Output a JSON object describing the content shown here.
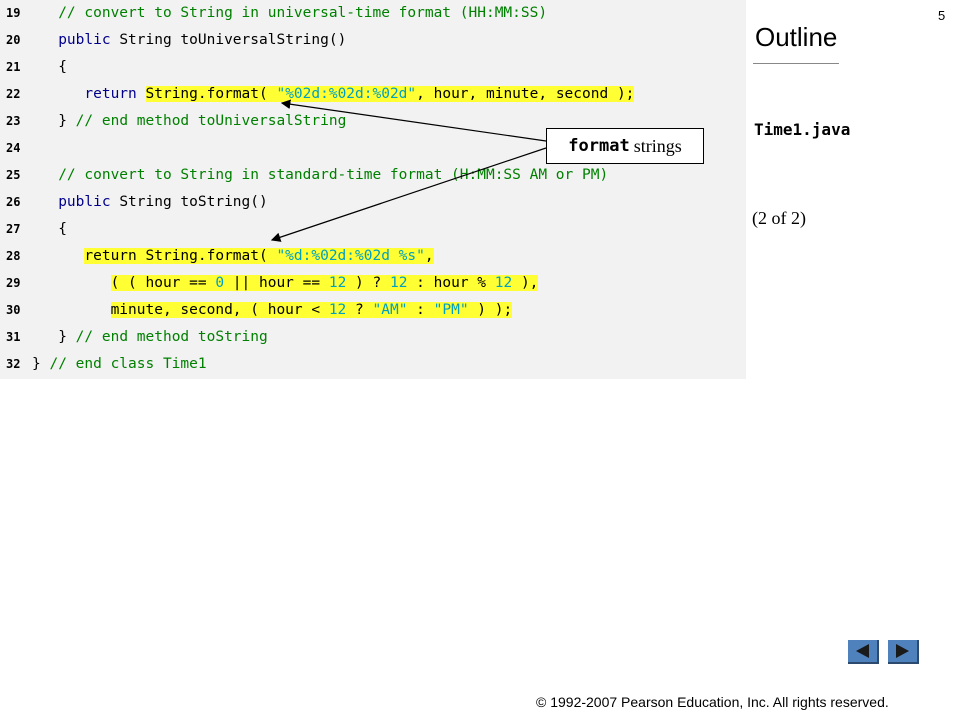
{
  "slide_number": "5",
  "sidebar": {
    "outline_title": "Outline",
    "filename": "Time1.java",
    "page_indicator": "(2 of 2)"
  },
  "callout": {
    "code_word": "format",
    "text": "strings"
  },
  "code_lines": [
    {
      "num": "19",
      "indent": "   ",
      "segments": [
        {
          "t": "// convert to String in universal-time format (HH:MM:SS)",
          "c": "cm"
        }
      ]
    },
    {
      "num": "20",
      "indent": "   ",
      "segments": [
        {
          "t": "public",
          "c": "kw"
        },
        {
          "t": " String toUniversalString()",
          "c": ""
        }
      ]
    },
    {
      "num": "21",
      "indent": "   ",
      "segments": [
        {
          "t": "{",
          "c": ""
        }
      ]
    },
    {
      "num": "22",
      "indent": "      ",
      "segments": [
        {
          "t": "return",
          "c": "kw"
        },
        {
          "t": " ",
          "c": ""
        },
        {
          "t": "String.format( ",
          "c": "hl"
        },
        {
          "t": "\"%02d:%02d:%02d\"",
          "c": "hl st"
        },
        {
          "t": ", hour, minute, second );",
          "c": "hl"
        }
      ]
    },
    {
      "num": "23",
      "indent": "   ",
      "segments": [
        {
          "t": "} ",
          "c": ""
        },
        {
          "t": "// end method toUniversalString",
          "c": "cm"
        }
      ]
    },
    {
      "num": "24",
      "indent": "",
      "segments": []
    },
    {
      "num": "25",
      "indent": "   ",
      "segments": [
        {
          "t": "// convert to String in standard-time format (H:MM:SS AM or PM)",
          "c": "cm"
        }
      ]
    },
    {
      "num": "26",
      "indent": "   ",
      "segments": [
        {
          "t": "public",
          "c": "kw"
        },
        {
          "t": " String toString()",
          "c": ""
        }
      ]
    },
    {
      "num": "27",
      "indent": "   ",
      "segments": [
        {
          "t": "{",
          "c": ""
        }
      ]
    },
    {
      "num": "28",
      "indent": "      ",
      "segments": [
        {
          "t": "return String.format( ",
          "c": "hl"
        },
        {
          "t": "\"%d:%02d:%02d %s\"",
          "c": "hl st"
        },
        {
          "t": ",",
          "c": "hl"
        }
      ]
    },
    {
      "num": "29",
      "indent": "         ",
      "segments": [
        {
          "t": "( ( hour == ",
          "c": "hl"
        },
        {
          "t": "0",
          "c": "hl nm"
        },
        {
          "t": " || hour == ",
          "c": "hl"
        },
        {
          "t": "12",
          "c": "hl nm"
        },
        {
          "t": " ) ? ",
          "c": "hl"
        },
        {
          "t": "12",
          "c": "hl nm"
        },
        {
          "t": " : hour % ",
          "c": "hl"
        },
        {
          "t": "12",
          "c": "hl nm"
        },
        {
          "t": " ),",
          "c": "hl"
        }
      ]
    },
    {
      "num": "30",
      "indent": "         ",
      "segments": [
        {
          "t": "minute, second, ( hour < ",
          "c": "hl"
        },
        {
          "t": "12",
          "c": "hl nm"
        },
        {
          "t": " ? ",
          "c": "hl"
        },
        {
          "t": "\"AM\"",
          "c": "hl st"
        },
        {
          "t": " : ",
          "c": "hl"
        },
        {
          "t": "\"PM\"",
          "c": "hl st"
        },
        {
          "t": " ) );",
          "c": "hl"
        }
      ]
    },
    {
      "num": "31",
      "indent": "   ",
      "segments": [
        {
          "t": "} ",
          "c": ""
        },
        {
          "t": "// end method toString",
          "c": "cm"
        }
      ]
    },
    {
      "num": "32",
      "indent": "",
      "segments": [
        {
          "t": "} ",
          "c": ""
        },
        {
          "t": "// end class Time1",
          "c": "cm"
        }
      ]
    }
  ],
  "navigation": {
    "prev_icon": "triangle-left-icon",
    "next_icon": "triangle-right-icon"
  },
  "footer": {
    "copyright": "© 1992-2007 Pearson Education, Inc.  All rights reserved."
  },
  "colors": {
    "highlight": "#ffff33",
    "keyword": "#00008b",
    "comment": "#008000",
    "literal": "#00a0c0",
    "nav_button": "#4f81bd"
  }
}
